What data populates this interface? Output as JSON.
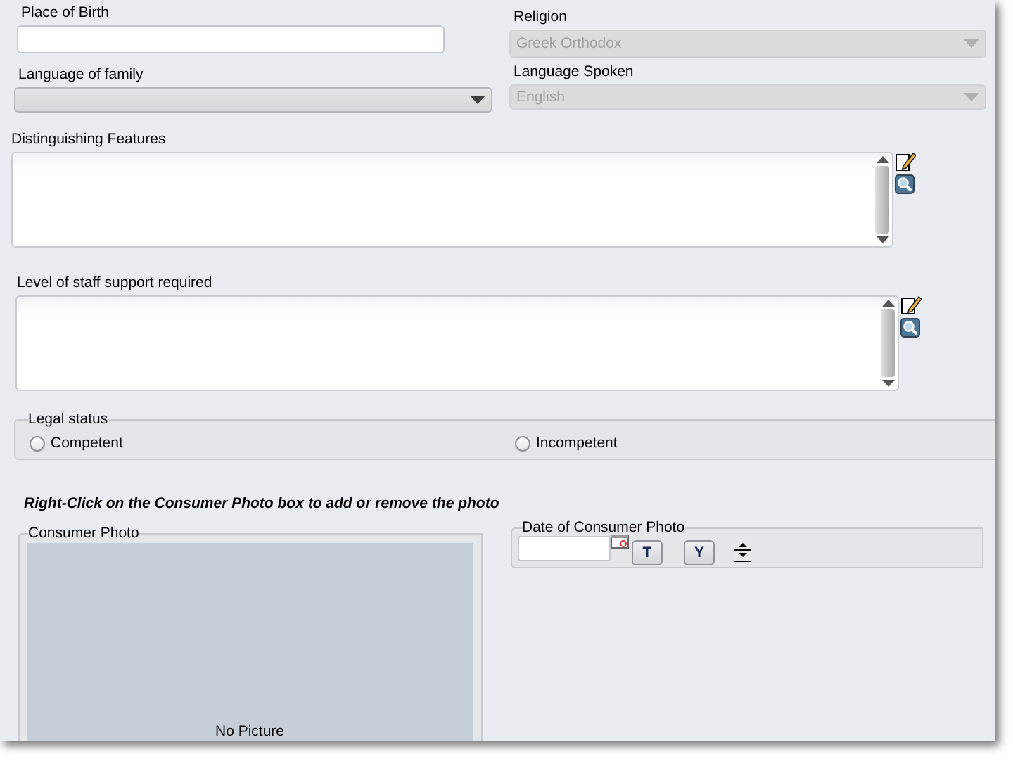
{
  "place_of_birth": {
    "label": "Place of Birth"
  },
  "religion": {
    "label": "Religion",
    "value": "Greek Orthodox",
    "disabled": true
  },
  "language_of_family": {
    "label": "Language of family",
    "disabled": false
  },
  "language_spoken": {
    "label": "Language Spoken",
    "value": "English",
    "disabled": true
  },
  "distinguishing_features": {
    "label": "Distinguishing Features"
  },
  "staff_support": {
    "label": "Level of staff support required"
  },
  "legal_status": {
    "label": "Legal status",
    "options": [
      {
        "label": "Competent",
        "selected": false
      },
      {
        "label": "Incompetent",
        "selected": false
      }
    ]
  },
  "photo_hint": "Right-Click on the Consumer Photo box to add or remove the photo",
  "consumer_photo": {
    "label": "Consumer Photo",
    "empty_text": "No Picture"
  },
  "photo_date": {
    "label": "Date of Consumer Photo",
    "buttons": [
      "T",
      "Y"
    ]
  }
}
